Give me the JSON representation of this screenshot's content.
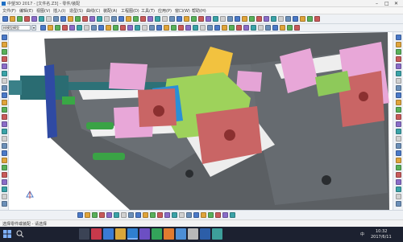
{
  "window": {
    "title": "中望3D 2017 - [文件名.Z3] - 零件/装配",
    "minimize_glyph": "–",
    "maximize_glyph": "□",
    "close_glyph": "✕"
  },
  "menu": [
    "文件(F)",
    "编辑(E)",
    "视图(V)",
    "插入(I)",
    "造型(S)",
    "曲线(C)",
    "装配(A)",
    "工程图(D)",
    "工具(T)",
    "应用(P)",
    "窗口(W)",
    "帮助(H)"
  ],
  "part_selector": {
    "value": "样模型模型",
    "arrow": "▾"
  },
  "colors": {
    "viewport_bg": "#ffffff",
    "base_plate": "#5b5f63",
    "pink_block": "#e8a7d8",
    "red_block": "#c96565",
    "blue_block": "#2b8fd6",
    "green_block": "#9ed25b",
    "yellow_block": "#f2c23f",
    "teal_cylinder": "#2a6c72",
    "navy_plate": "#2f4aa3",
    "green_spring": "#3aa345",
    "taskbar_bg": "#1c2130"
  },
  "icons": [
    "search-icon",
    "file-icon",
    "app-icon",
    "view-cube-icon"
  ],
  "status": {
    "text": "选择零件或装配 - 请选择"
  },
  "tray": {
    "language": "中",
    "time": "10:32",
    "date": "2017/6/11"
  }
}
